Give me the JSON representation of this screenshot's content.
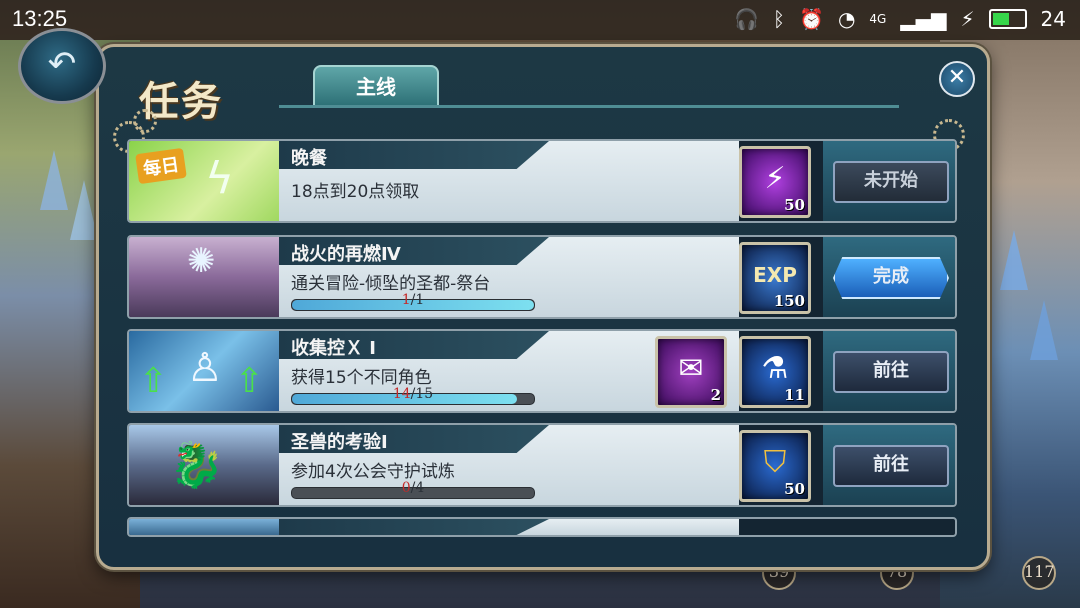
{
  "status_bar": {
    "time": "13:25",
    "network": "4G",
    "battery_level": "24"
  },
  "panel": {
    "title": "任务",
    "tabs": [
      {
        "label": "主线",
        "active": true
      }
    ],
    "close_label": "✕"
  },
  "quests": [
    {
      "thumb_label": "每日",
      "title": "晚餐",
      "description": "18点到20点领取",
      "progress": null,
      "rewards": [
        {
          "icon": "lightning-crystal-icon",
          "qty": "50"
        }
      ],
      "action": {
        "label": "未开始",
        "state": "inactive"
      }
    },
    {
      "thumb_label": "",
      "title": "战火的再燃Ⅳ",
      "description": "通关冒险-倾坠的圣都-祭台",
      "progress": {
        "current": "1",
        "total": "/1",
        "fraction": 1.0
      },
      "rewards": [
        {
          "icon": "exp-icon",
          "qty": "150"
        }
      ],
      "action": {
        "label": "完成",
        "state": "complete"
      }
    },
    {
      "thumb_label": "",
      "title": "收集控Ｘ Ⅰ",
      "description": "获得15个不同角色",
      "progress": {
        "current": "14",
        "total": "/15",
        "fraction": 0.93
      },
      "rewards": [
        {
          "icon": "letter-icon",
          "qty": "2"
        },
        {
          "icon": "potion-bottle-icon",
          "qty": "11"
        }
      ],
      "action": {
        "label": "前往",
        "state": "go"
      }
    },
    {
      "thumb_label": "",
      "title": "圣兽的考验Ⅰ",
      "description": "参加4次公会守护试炼",
      "progress": {
        "current": "0",
        "total": "/4",
        "fraction": 0.0
      },
      "rewards": [
        {
          "icon": "golden-emblem-icon",
          "qty": "50"
        }
      ],
      "action": {
        "label": "前往",
        "state": "go"
      }
    }
  ],
  "colors": {
    "accent_tab": "#2b6e74",
    "complete_button": "#1b5fb8",
    "progress_current": "#c42a2a"
  },
  "background_badges": [
    "39",
    "78",
    "117"
  ]
}
